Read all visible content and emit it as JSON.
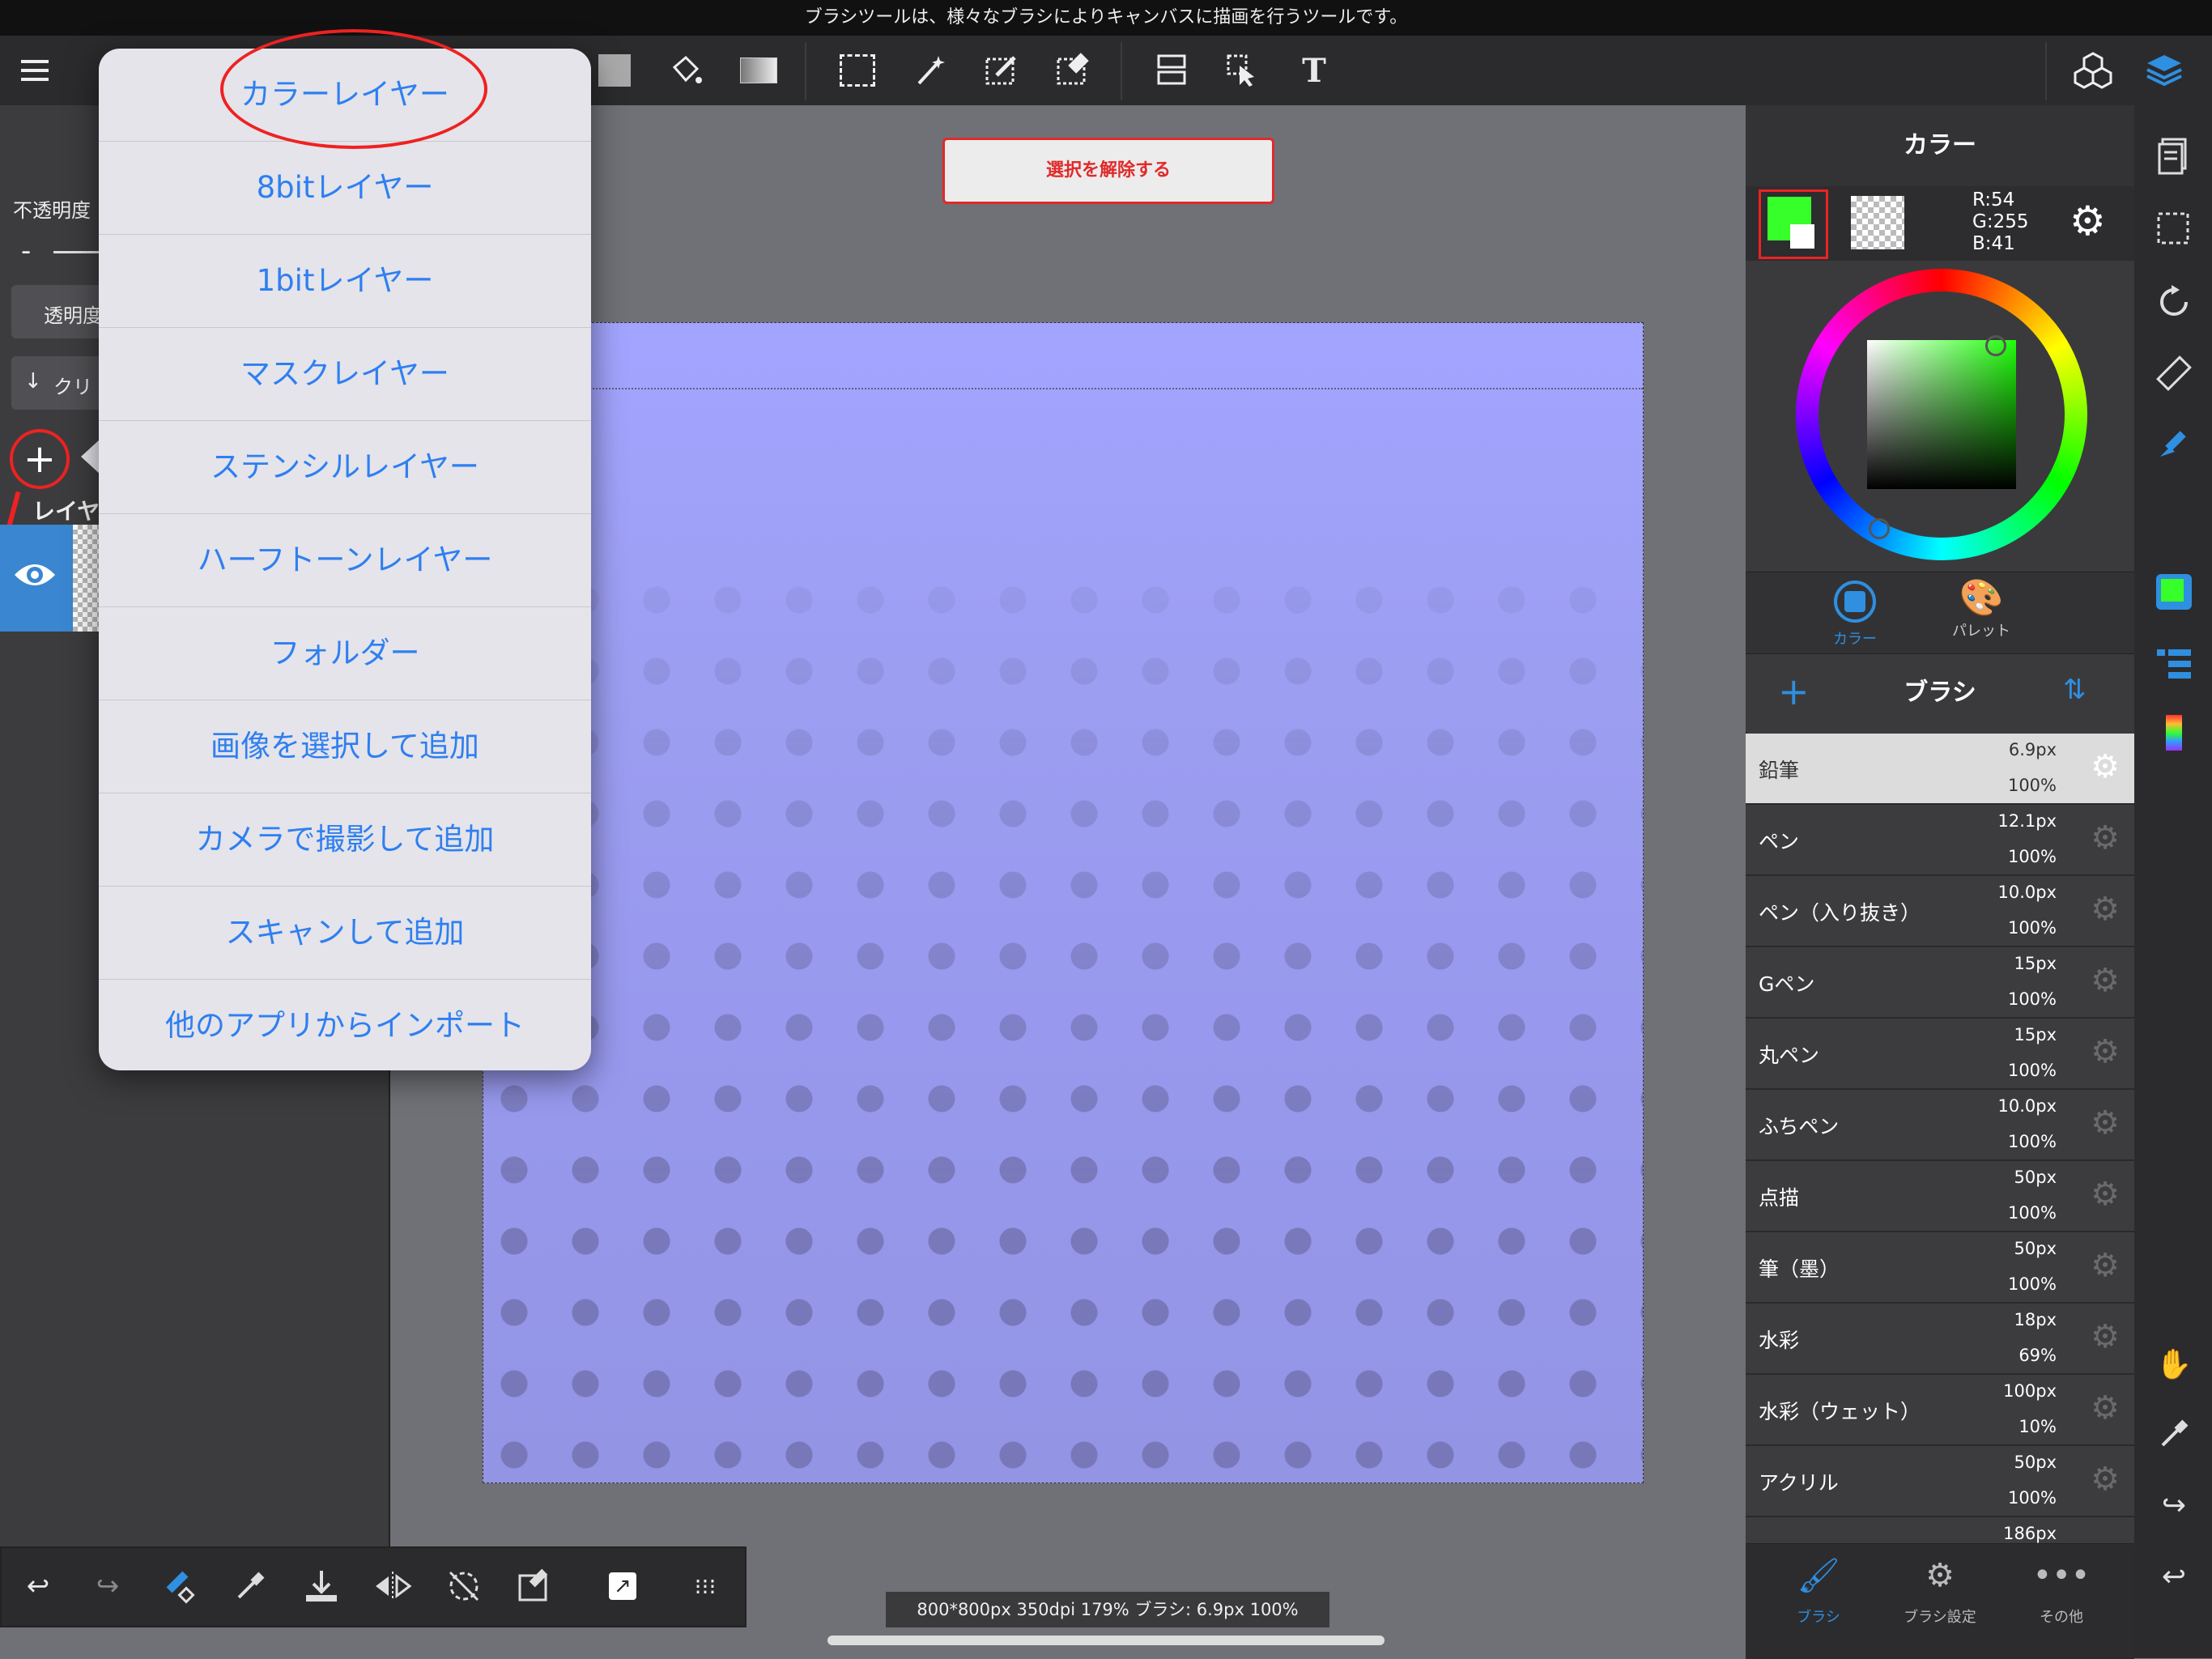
{
  "hint_bar": {
    "text": "ブラシツールは、様々なブラシによりキャンバスに描画を行うツールです。"
  },
  "toolbar": {
    "icons": [
      "menu-icon",
      "color-swatch-icon",
      "fill-bucket-icon",
      "gradient-icon",
      "select-rect-icon",
      "magic-wand-icon",
      "select-pen-icon",
      "select-eraser-icon",
      "transform-icon",
      "move-icon",
      "text-icon"
    ],
    "right_icons": [
      "material-icon",
      "layers-icon"
    ],
    "text_icon_label": "T"
  },
  "layer_panel": {
    "opacity_label": "不透明度",
    "minus_label": "-",
    "protect_label": "透明度",
    "clip_label": "クリ",
    "layer_label": "レイヤ"
  },
  "popup_menu": {
    "items": [
      "カラーレイヤー",
      "8bitレイヤー",
      "1bitレイヤー",
      "マスクレイヤー",
      "ステンシルレイヤー",
      "ハーフトーンレイヤー",
      "フォルダー",
      "画像を選択して追加",
      "カメラで撮影して追加",
      "スキャンして追加",
      "他のアプリからインポート"
    ]
  },
  "canvas": {
    "deselect_label": "選択を解除する",
    "status": "800*800px 350dpi 179% ブラシ: 6.9px 100%"
  },
  "color_panel": {
    "title": "カラー",
    "fg_color": "#36ff29",
    "rgb": {
      "r": "R:54",
      "g": "G:255",
      "b": "B:41"
    },
    "tabs": [
      {
        "label": "カラー",
        "active": true
      },
      {
        "label": "パレット",
        "active": false
      }
    ]
  },
  "brush_panel": {
    "title": "ブラシ",
    "add_label": "+",
    "brushes": [
      {
        "name": "鉛筆",
        "size": "6.9px",
        "opacity": "100%",
        "active": true
      },
      {
        "name": "ペン",
        "size": "12.1px",
        "opacity": "100%"
      },
      {
        "name": "ペン（入り抜き）",
        "size": "10.0px",
        "opacity": "100%"
      },
      {
        "name": "Gペン",
        "size": "15px",
        "opacity": "100%"
      },
      {
        "name": "丸ペン",
        "size": "15px",
        "opacity": "100%"
      },
      {
        "name": "ふちペン",
        "size": "10.0px",
        "opacity": "100%"
      },
      {
        "name": "点描",
        "size": "50px",
        "opacity": "100%"
      },
      {
        "name": "筆（墨）",
        "size": "50px",
        "opacity": "100%"
      },
      {
        "name": "水彩",
        "size": "18px",
        "opacity": "69%"
      },
      {
        "name": "水彩（ウェット）",
        "size": "100px",
        "opacity": "10%"
      },
      {
        "name": "アクリル",
        "size": "50px",
        "opacity": "100%"
      },
      {
        "name": "",
        "size": "186px",
        "opacity": ""
      }
    ],
    "bottom_tabs": [
      {
        "label": "ブラシ",
        "active": true
      },
      {
        "label": "ブラシ設定"
      },
      {
        "label": "その他"
      }
    ]
  },
  "quick_bar": {
    "icons": [
      "undo-icon",
      "redo-icon",
      "brush-eraser-icon",
      "eyedropper-icon",
      "save-icon",
      "flip-icon",
      "rotate-reset-icon",
      "select-edit-icon",
      "export-icon",
      "grid-icon"
    ]
  },
  "accent": {
    "menu_text": "#2f7ff0",
    "highlight_red": "#e22222",
    "active_blue": "#2f8fe0"
  }
}
